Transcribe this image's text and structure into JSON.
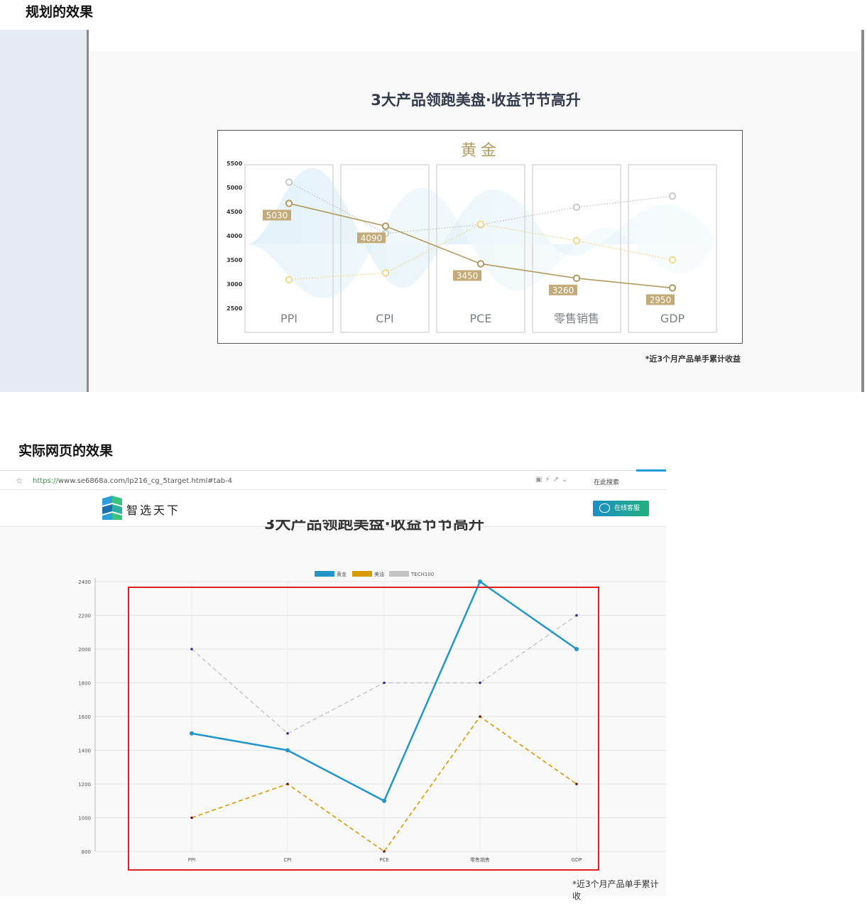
{
  "sections": {
    "design_title": "规划的效果",
    "actual_title": "实际网页的效果"
  },
  "mockup": {
    "heading": "3大产品领跑美盘·收益节节高升",
    "note": "*近3个月产品单手累计收益"
  },
  "browser": {
    "url_proto": "https://",
    "url_rest": "www.se6868a.com/lp216_cg_5target.html#tab-4",
    "search_label": "在此搜索",
    "logo_text": "智选天下",
    "service_button": "在线客服",
    "cut_heading": "3大产品领跑美盘·收益节节高升",
    "note": "*近3个月产品单手累计收"
  },
  "colors": {
    "gold": "#b09a5e",
    "gold_label_bg": "#c2ab78",
    "light_gold": "#f2d98a",
    "gray": "#c8c8c8",
    "blue": "#2396c9",
    "orange": "#d99a00",
    "dash_gray": "#c4c4c4",
    "highlight_red": "#e02020"
  },
  "chart_data": [
    {
      "type": "line",
      "title": "黄金",
      "categories": [
        "PPI",
        "CPI",
        "PCE",
        "零售销售",
        "GDP"
      ],
      "ylim": [
        2500,
        5500
      ],
      "yticks": [
        5500,
        5000,
        4500,
        4000,
        3500,
        3000,
        2500
      ],
      "grid": false,
      "series": [
        {
          "values": [
            4670,
            4200,
            3420,
            3120,
            2920
          ],
          "labels": [
            "5030",
            "4090",
            "3450",
            "3260",
            "2950"
          ]
        },
        {
          "values": [
            3090,
            3230,
            4240,
            3900,
            3500
          ]
        },
        {
          "values": [
            5110,
            4050,
            4230,
            4590,
            4820
          ]
        }
      ]
    },
    {
      "type": "line",
      "categories": [
        "PPI",
        "CPI",
        "PCE",
        "零售销售",
        "GDP"
      ],
      "ylim": [
        800,
        2400
      ],
      "yticks": [
        2400,
        2200,
        2000,
        1800,
        1600,
        1400,
        1200,
        1000,
        800
      ],
      "grid": true,
      "legend": "top-center",
      "series": [
        {
          "name": "黄金",
          "values": [
            1500,
            1400,
            1100,
            2400,
            2000
          ]
        },
        {
          "name": "美油",
          "values": [
            1000,
            1200,
            800,
            1600,
            1200
          ]
        },
        {
          "name": "TECH100",
          "values": [
            2000,
            1500,
            1800,
            1800,
            2200
          ]
        }
      ]
    }
  ]
}
